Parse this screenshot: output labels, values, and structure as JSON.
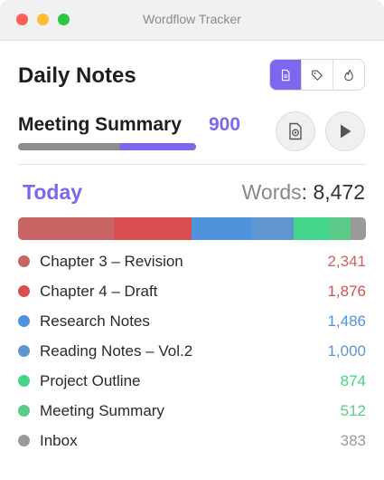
{
  "window": {
    "title": "Wordflow Tracker"
  },
  "header": {
    "title": "Daily Notes",
    "view_buttons": [
      {
        "icon": "document-icon",
        "active": true
      },
      {
        "icon": "tag-icon",
        "active": false
      },
      {
        "icon": "flame-icon",
        "active": false
      }
    ]
  },
  "current": {
    "name": "Meeting Summary",
    "count": "900",
    "progress": 0.43
  },
  "summary": {
    "period": "Today",
    "words_label": "Words",
    "separator": ":",
    "words_value": "8,472"
  },
  "colors": {
    "accent": "#7b68ee"
  },
  "documents": [
    {
      "name": "Chapter 3 – Revision",
      "words": "2,341",
      "value": 2341,
      "color": "#c96464"
    },
    {
      "name": "Chapter 4 – Draft",
      "words": "1,876",
      "value": 1876,
      "color": "#d94f4f"
    },
    {
      "name": "Research Notes",
      "words": "1,486",
      "value": 1486,
      "color": "#4f93dc"
    },
    {
      "name": "Reading Notes – Vol.2",
      "words": "1,000",
      "value": 1000,
      "color": "#5f96cf"
    },
    {
      "name": "Project Outline",
      "words": "874",
      "value": 874,
      "color": "#43d68a"
    },
    {
      "name": "Meeting Summary",
      "words": "512",
      "value": 512,
      "color": "#5ccb8a"
    },
    {
      "name": "Inbox",
      "words": "383",
      "value": 383,
      "color": "#9a9a9a"
    }
  ]
}
